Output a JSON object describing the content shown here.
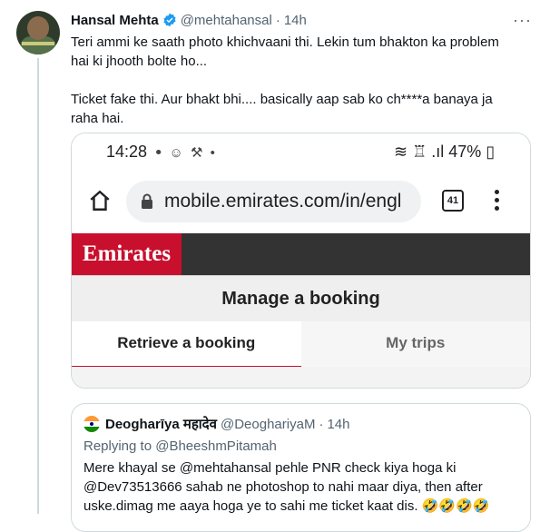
{
  "tweet": {
    "author_name": "Hansal Mehta",
    "author_handle": "@mehtahansal",
    "separator": "·",
    "time": "14h",
    "more_label": "···",
    "paragraphs": [
      "Teri ammi ke saath photo khichvaani thi. Lekin tum bhakton ka problem hai ki jhooth bolte ho...",
      "Ticket fake thi. Aur bhakt bhi.... basically aap sab ko ch****a banaya ja raha hai."
    ]
  },
  "screenshot": {
    "clock": "14:28",
    "status_icons_left": "ꔷ ☺ ⚒ •",
    "status_right": "≋ ♖ .ıl 47% ▯",
    "url": "mobile.emirates.com/in/engl",
    "tab_count": "41",
    "brand": "Emirates",
    "manage_title": "Manage a booking",
    "tabs": [
      "Retrieve a booking",
      "My trips"
    ],
    "accent_color": "#c8102e"
  },
  "quoted": {
    "author_name": "Deogharīya महादेव",
    "author_handle": "@DeoghariyaM",
    "separator": "·",
    "time": "14h",
    "replying_to": "Replying to @BheeshmPitamah",
    "text": "Mere khayal se @mehtahansal pehle PNR check kiya hoga ki @Dev73513666 sahab ne photoshop to nahi maar diya, then after uske.dimag me aaya hoga ye to sahi me ticket kaat dis. 🤣🤣🤣🤣"
  }
}
